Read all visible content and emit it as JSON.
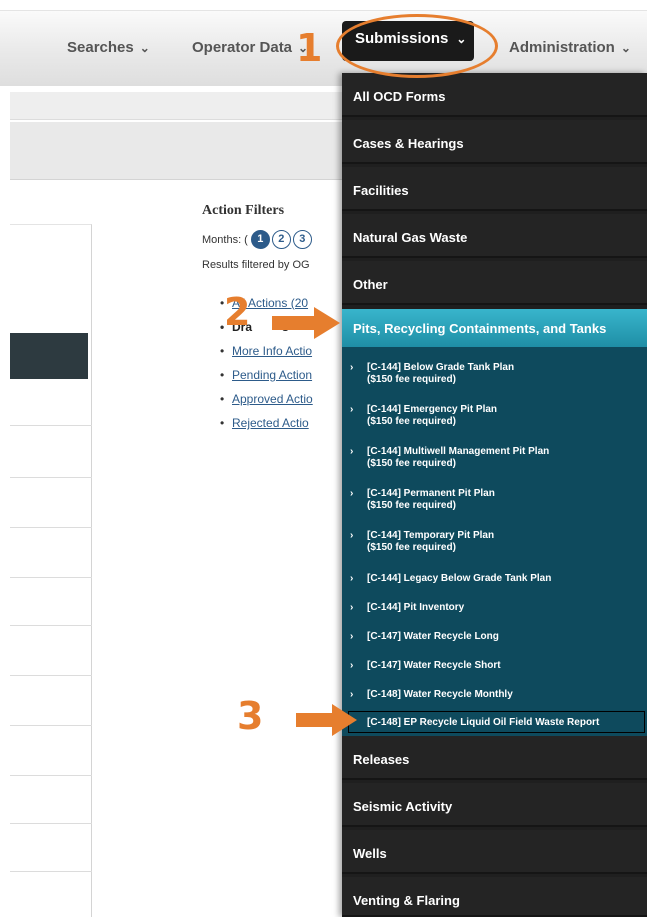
{
  "nav": {
    "searches": "Searches",
    "operator_data": "Operator Data",
    "submissions": "Submissions",
    "administration": "Administration",
    "chevron": "⌄"
  },
  "action_filters": {
    "title": "Action Filters",
    "months_label": "Months: (",
    "months": [
      "1",
      "2",
      "3"
    ],
    "active_month": "1",
    "note": "Results filtered by OG",
    "links": [
      "All Actions (20",
      "Dra",
      "More Info Actio",
      "Pending Action",
      "Approved Actio",
      "Rejected Actio"
    ],
    "links_partial": "s"
  },
  "dropdown": {
    "top_items": [
      "All OCD Forms",
      "Cases & Hearings",
      "Facilities",
      "Natural Gas Waste",
      "Other"
    ],
    "active_item": "Pits, Recycling Containments, and Tanks",
    "sub_items": [
      {
        "line1": "[C-144] Below Grade Tank Plan",
        "line2": "($150 fee required)"
      },
      {
        "line1": "[C-144] Emergency Pit Plan",
        "line2": "($150 fee required)"
      },
      {
        "line1": "[C-144] Multiwell Management Pit Plan",
        "line2": "($150 fee required)"
      },
      {
        "line1": "[C-144] Permanent Pit Plan",
        "line2": "($150 fee required)"
      },
      {
        "line1": "[C-144] Temporary Pit Plan",
        "line2": "($150 fee required)"
      },
      {
        "line1": "[C-144] Legacy Below Grade Tank Plan"
      },
      {
        "line1": "[C-144] Pit Inventory"
      },
      {
        "line1": "[C-147] Water Recycle Long"
      },
      {
        "line1": "[C-147] Water Recycle Short"
      },
      {
        "line1": "[C-148] Water Recycle Monthly"
      }
    ],
    "highlighted_sub_item": "[C-148] EP Recycle Liquid Oil Field Waste Report",
    "bottom_items": [
      "Releases",
      "Seismic Activity",
      "Wells",
      "Venting & Flaring"
    ]
  },
  "annotations": {
    "step1": "1",
    "step2": "2",
    "step3": "3",
    "color": "#e67e2e"
  },
  "colors": {
    "dropdown_bg": "#242424",
    "active_item": "#2aa3bb",
    "submenu_bg": "#0e4a5d",
    "link": "#2d5b8a"
  }
}
